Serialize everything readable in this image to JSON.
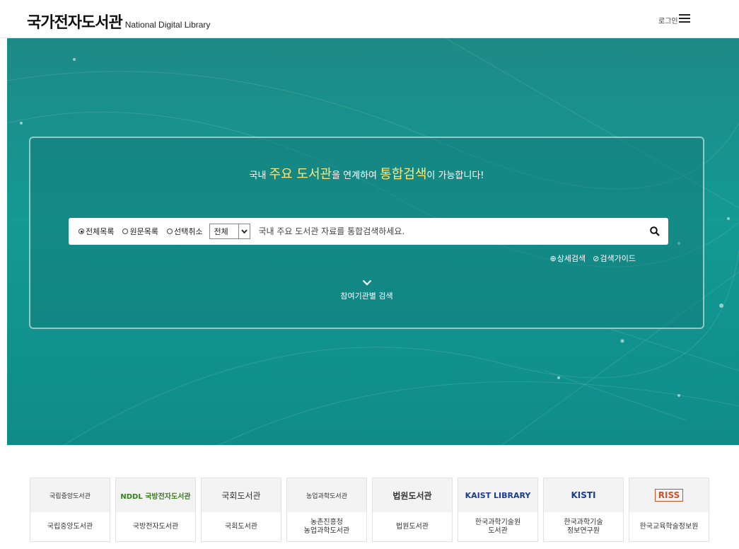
{
  "header": {
    "title_kr": "국가전자도서관",
    "title_en": "National Digital Library",
    "login_label": "로그인"
  },
  "hero": {
    "headline": {
      "pre": "국내 ",
      "hl1": "주요 도서관",
      "mid": "을 연계하여 ",
      "hl2": "통합검색",
      "post": "이 가능합니다!"
    },
    "radios": [
      {
        "label": "전체목록",
        "checked": true
      },
      {
        "label": "원문목록",
        "checked": false
      },
      {
        "label": "선택취소",
        "checked": false
      }
    ],
    "select_value": "전체",
    "search_placeholder": "국내 주요 도서관 자료를 통합검색하세요.",
    "advanced_search": "상세검색",
    "search_guide": "검색가이드",
    "institution_search": "참여기관별 검색"
  },
  "institutions": [
    {
      "logo": "국립중앙도서관",
      "name": "국립중앙도서관"
    },
    {
      "logo": "NDDL 국방전자도서관",
      "name": "국방전자도서관"
    },
    {
      "logo": "국회도서관",
      "name": "국회도서관"
    },
    {
      "logo": "농업과학도서관",
      "name": "농촌진흥청\n농업과학도서관"
    },
    {
      "logo": "법원도서관",
      "name": "법원도서관"
    },
    {
      "logo": "KAIST LIBRARY",
      "name": "한국과학기술원\n도서관"
    },
    {
      "logo": "KISTI",
      "name": "한국과학기술\n정보연구원"
    },
    {
      "logo": "RISS",
      "name": "한국교육학술정보원"
    }
  ],
  "colors": {
    "hero_bg": "#149994",
    "highlight": "#ffe873"
  }
}
